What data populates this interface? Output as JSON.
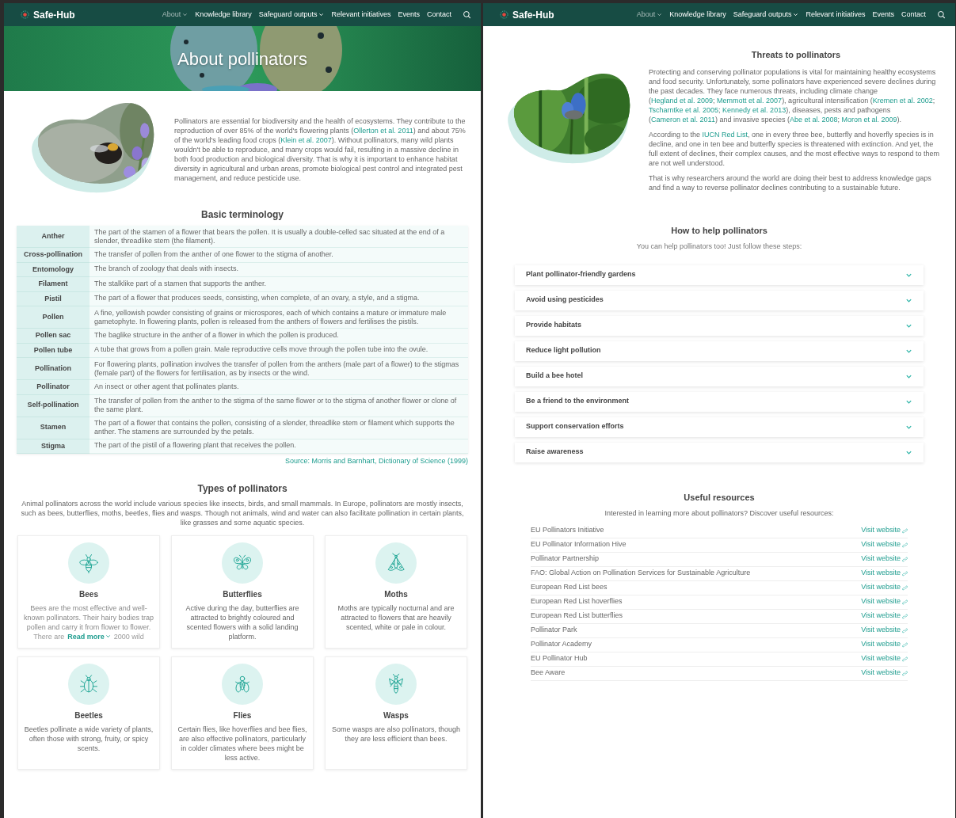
{
  "left_page": {
    "nav": {
      "logo": "Safe-Hub",
      "items": [
        {
          "label": "About",
          "dropdown": true,
          "selected": true
        },
        {
          "label": "Knowledge library",
          "dropdown": false,
          "selected": false
        },
        {
          "label": "Safeguard outputs",
          "dropdown": true,
          "selected": false
        },
        {
          "label": "Relevant initiatives",
          "dropdown": false,
          "selected": false
        },
        {
          "label": "Events",
          "dropdown": false,
          "selected": false
        },
        {
          "label": "Contact",
          "dropdown": false,
          "selected": false
        }
      ]
    },
    "hero": {
      "title": "About pollinators"
    },
    "intro": [
      {
        "kind": "text",
        "text": "Pollinators are essential for biodiversity and the health of ecosystems. They contribute to the reproduction of over 85% of the world's flowering plants ("
      },
      {
        "kind": "link",
        "text": "Ollerton et al. 2011"
      },
      {
        "kind": "text",
        "text": ") and about 75% of the world's leading food crops ("
      },
      {
        "kind": "link",
        "text": "Klein et al. 2007"
      },
      {
        "kind": "text",
        "text": "). Without pollinators, many wild plants wouldn't be able to reproduce, and many crops would fail, resulting in a massive decline in both food production and biological diversity. That is why it is important to enhance habitat diversity in agricultural and urban areas, promote biological pest control and integrated pest management, and reduce pesticide use."
      }
    ],
    "terminology": {
      "title": "Basic terminology",
      "rows": [
        {
          "term": "Anther",
          "definition": "The part of the stamen of a flower that bears the pollen. It is usually a double-celled sac situated at the end of a slender, threadlike stem (the filament)."
        },
        {
          "term": "Cross-pollination",
          "definition": "The transfer of pollen from the anther of one flower to the stigma of another."
        },
        {
          "term": "Entomology",
          "definition": "The branch of zoology that deals with insects."
        },
        {
          "term": "Filament",
          "definition": "The stalklike part of a stamen that supports the anther."
        },
        {
          "term": "Pistil",
          "definition": "The part of a flower that produces seeds, consisting, when complete, of an ovary, a style, and a stigma."
        },
        {
          "term": "Pollen",
          "definition": "A fine, yellowish powder consisting of grains or microspores, each of which contains a mature or immature male gametophyte. In flowering plants, pollen is released from the anthers of flowers and fertilises the pistils."
        },
        {
          "term": "Pollen sac",
          "definition": "The baglike structure in the anther of a flower in which the pollen is produced."
        },
        {
          "term": "Pollen tube",
          "definition": "A tube that grows from a pollen grain. Male reproductive cells move through the pollen tube into the ovule."
        },
        {
          "term": "Pollination",
          "definition": "For flowering plants, pollination involves the transfer of pollen from the anthers (male part of a flower) to the stigmas (female part) of the flowers for fertilisation, as by insects or the wind."
        },
        {
          "term": "Pollinator",
          "definition": "An insect or other agent that pollinates plants."
        },
        {
          "term": "Self-pollination",
          "definition": "The transfer of pollen from the anther to the stigma of the same flower or to the stigma of another flower or clone of the same plant."
        },
        {
          "term": "Stamen",
          "definition": "The part of a flower that contains the pollen, consisting of a slender, threadlike stem or filament which supports the anther. The stamens are surrounded by the petals."
        },
        {
          "term": "Stigma",
          "definition": "The part of the pistil of a flowering plant that receives the pollen."
        }
      ],
      "source": "Source: Morris and Barnhart, Dictionary of Science (1999)"
    },
    "types": {
      "title": "Types of pollinators",
      "intro": "Animal pollinators across the world include various species like insects, birds, and small mammals. In Europe, pollinators are mostly insects, such as bees, butterflies, moths, beetles, flies and wasps. Though not animals, wind and water can also facilitate pollination in certain plants, like grasses and some aquatic species.",
      "cards": [
        {
          "title": "Bees",
          "description": "Bees are the most effective and well-known pollinators. Their hairy bodies trap pollen and carry it from flower to flower.",
          "collapsed": true,
          "cut_line": [
            "There are",
            "2000 wild"
          ],
          "read_more": "Read more"
        },
        {
          "title": "Butterflies",
          "description": "Active during the day, butterflies are attracted to brightly coloured and scented flowers with a solid landing platform.",
          "collapsed": false
        },
        {
          "title": "Moths",
          "description": "Moths are typically nocturnal and are attracted to flowers that are heavily scented, white or pale in colour.",
          "collapsed": false
        },
        {
          "title": "Beetles",
          "description": "Beetles pollinate a wide variety of plants, often those with strong, fruity, or spicy scents.",
          "collapsed": false
        },
        {
          "title": "Flies",
          "description": "Certain flies, like hoverflies and bee flies, are also effective pollinators, particularly in colder climates where bees might be less active.",
          "collapsed": false
        },
        {
          "title": "Wasps",
          "description": "Some wasps are also pollinators, though they are less efficient than bees.",
          "collapsed": false
        }
      ]
    }
  },
  "right_page": {
    "nav": {
      "logo": "Safe-Hub",
      "items": [
        {
          "label": "About",
          "dropdown": true,
          "selected": true
        },
        {
          "label": "Knowledge library",
          "dropdown": false,
          "selected": false
        },
        {
          "label": "Safeguard outputs",
          "dropdown": true,
          "selected": false
        },
        {
          "label": "Relevant initiatives",
          "dropdown": false,
          "selected": false
        },
        {
          "label": "Events",
          "dropdown": false,
          "selected": false
        },
        {
          "label": "Contact",
          "dropdown": false,
          "selected": false
        }
      ]
    },
    "threats": {
      "title": "Threats to pollinators",
      "paragraphs": [
        [
          {
            "kind": "text",
            "text": "Protecting and conserving pollinator populations is vital for maintaining healthy ecosystems and food security. Unfortunately, some pollinators have experienced severe declines during the past decades. They face numerous threats, including climate change ("
          },
          {
            "kind": "link",
            "text": "Hegland et al. 2009"
          },
          {
            "kind": "text",
            "text": "; "
          },
          {
            "kind": "link",
            "text": "Memmott et al. 2007"
          },
          {
            "kind": "text",
            "text": "), agricultural intensification ("
          },
          {
            "kind": "link",
            "text": "Kremen et al. 2002"
          },
          {
            "kind": "text",
            "text": "; "
          },
          {
            "kind": "link",
            "text": "Tscharntke et al. 2005"
          },
          {
            "kind": "text",
            "text": "; "
          },
          {
            "kind": "link",
            "text": "Kennedy et al. 2013"
          },
          {
            "kind": "text",
            "text": "), diseases, pests and pathogens ("
          },
          {
            "kind": "link",
            "text": "Cameron et al. 2011"
          },
          {
            "kind": "text",
            "text": ") and invasive species ("
          },
          {
            "kind": "link",
            "text": "Abe et al. 2008"
          },
          {
            "kind": "text",
            "text": "; "
          },
          {
            "kind": "link",
            "text": "Moron et al. 2009"
          },
          {
            "kind": "text",
            "text": ")."
          }
        ],
        [
          {
            "kind": "text",
            "text": "According to the "
          },
          {
            "kind": "link",
            "text": "IUCN Red List"
          },
          {
            "kind": "text",
            "text": ", one in every three bee, butterfly and hoverfly species is in decline, and one in ten bee and butterfly species is threatened with extinction. And yet, the full extent of declines, their complex causes, and the most effective ways to respond to them are not well understood."
          }
        ],
        [
          {
            "kind": "text",
            "text": "That is why researchers around the world are doing their best to address knowledge gaps and find a way to reverse pollinator declines contributing to a sustainable future."
          }
        ]
      ]
    },
    "help": {
      "title": "How to help pollinators",
      "subtitle": "You can help pollinators too! Just follow these steps:",
      "items": [
        {
          "label": "Plant pollinator-friendly gardens",
          "expanded": false
        },
        {
          "label": "Avoid using pesticides",
          "expanded": false
        },
        {
          "label": "Provide habitats",
          "expanded": false
        },
        {
          "label": "Reduce light pollution",
          "expanded": false
        },
        {
          "label": "Build a bee hotel",
          "expanded": false
        },
        {
          "label": "Be a friend to the environment",
          "expanded": false
        },
        {
          "label": "Support conservation efforts",
          "expanded": false
        },
        {
          "label": "Raise awareness",
          "expanded": false
        }
      ]
    },
    "resources": {
      "title": "Useful resources",
      "subtitle": "Interested in learning more about pollinators? Discover useful resources:",
      "items": [
        {
          "name": "EU Pollinators Initiative",
          "link": "Visit website"
        },
        {
          "name": "EU Pollinator Information Hive",
          "link": "Visit website"
        },
        {
          "name": "Pollinator Partnership",
          "link": "Visit website"
        },
        {
          "name": "FAO: Global Action on Pollination Services for Sustainable Agriculture",
          "link": "Visit website"
        },
        {
          "name": "European Red List bees",
          "link": "Visit website"
        },
        {
          "name": "European Red List hoverflies",
          "link": "Visit website"
        },
        {
          "name": "European Red List butterflies",
          "link": "Visit website"
        },
        {
          "name": "Pollinator Park",
          "link": "Visit website"
        },
        {
          "name": "Pollinator Academy",
          "link": "Visit website"
        },
        {
          "name": "EU Pollinator Hub",
          "link": "Visit website"
        },
        {
          "name": "Bee Aware",
          "link": "Visit website"
        }
      ]
    }
  }
}
